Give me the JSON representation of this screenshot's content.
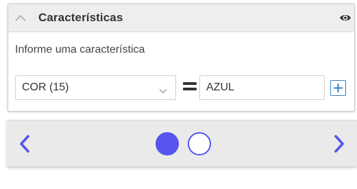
{
  "panel": {
    "title": "Características",
    "label": "Informe uma característica",
    "select": {
      "value": "COR (15)"
    },
    "input": {
      "value": "AZUL"
    },
    "icons": {
      "collapse": "chevron-up-icon",
      "visibility": "eye-icon",
      "select": "chevron-down-icon",
      "equals": "equals-icon",
      "add": "plus-icon"
    }
  },
  "carousel": {
    "total_pages": 2,
    "current_page": 1,
    "icons": {
      "previous": "chevron-left-icon",
      "next": "chevron-right-icon"
    }
  },
  "colors": {
    "accent": "#5555ee",
    "add_button": "#3a82c6",
    "header_background": "#eeeeee",
    "carousel_background": "#eaeaea"
  }
}
